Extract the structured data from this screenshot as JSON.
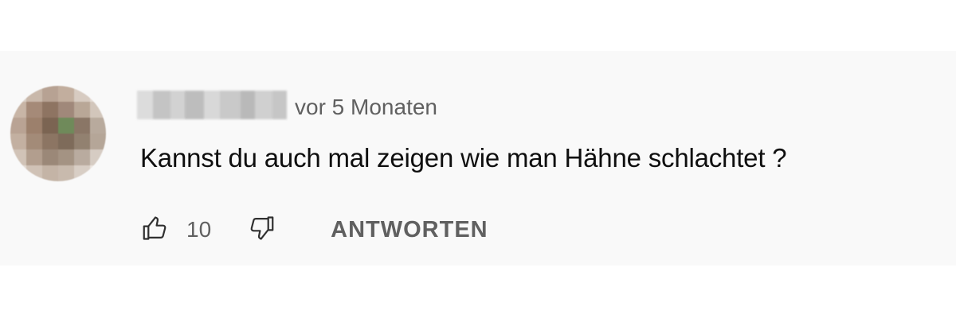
{
  "comment": {
    "timestamp": "vor 5 Monaten",
    "text": "Kannst du auch mal zeigen wie man Hähne schlachtet ?",
    "like_count": "10",
    "reply_label": "ANTWORTEN"
  },
  "icons": {
    "like": "thumbs-up-icon",
    "dislike": "thumbs-down-icon"
  },
  "colors": {
    "card_background": "#f9f9f9",
    "primary_text": "#0f0f0f",
    "secondary_text": "#606060"
  }
}
